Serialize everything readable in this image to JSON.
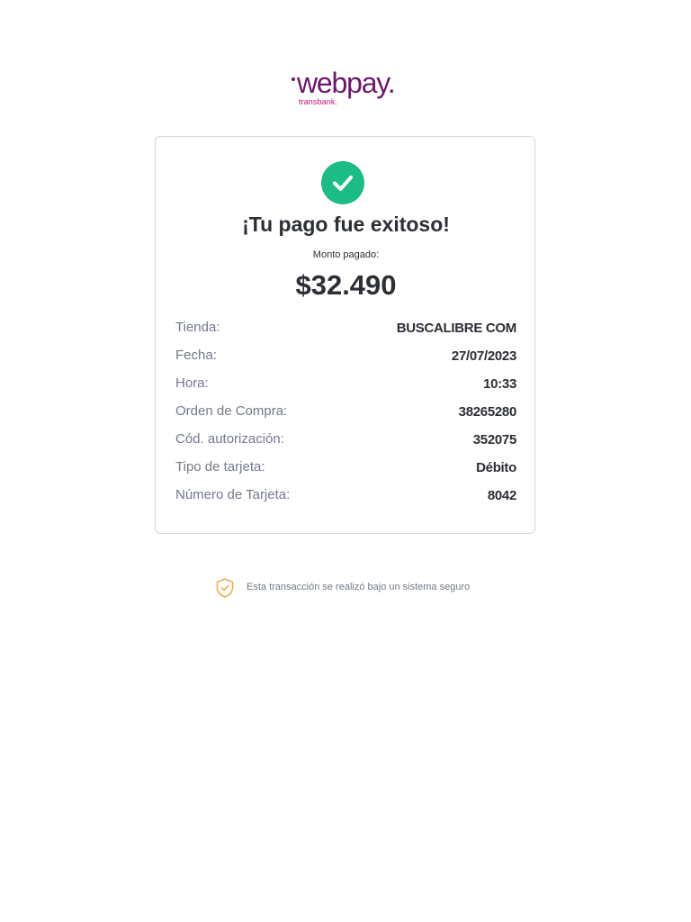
{
  "logo": {
    "main": "webpay.",
    "sub": "transbank."
  },
  "result": {
    "title": "¡Tu pago fue exitoso!",
    "amount_label": "Monto pagado:",
    "amount": "$32.490"
  },
  "details": [
    {
      "label": "Tienda:",
      "value": "BUSCALIBRE COM"
    },
    {
      "label": "Fecha:",
      "value": "27/07/2023"
    },
    {
      "label": "Hora:",
      "value": "10:33"
    },
    {
      "label": "Orden de Compra:",
      "value": "38265280"
    },
    {
      "label": "Cód. autorización:",
      "value": "352075"
    },
    {
      "label": "Tipo de tarjeta:",
      "value": "Débito"
    },
    {
      "label": "Número de Tarjeta:",
      "value": "8042"
    }
  ],
  "footer": {
    "secure_text": "Esta transacción se realizó bajo un sistema seguro"
  },
  "icons": {
    "success": "check-circle-icon",
    "secure": "shield-check-icon"
  },
  "colors": {
    "brand": "#6b196b",
    "brand_accent": "#c40f7f",
    "success": "#1dbc86",
    "secure_icon": "#f0a040"
  }
}
